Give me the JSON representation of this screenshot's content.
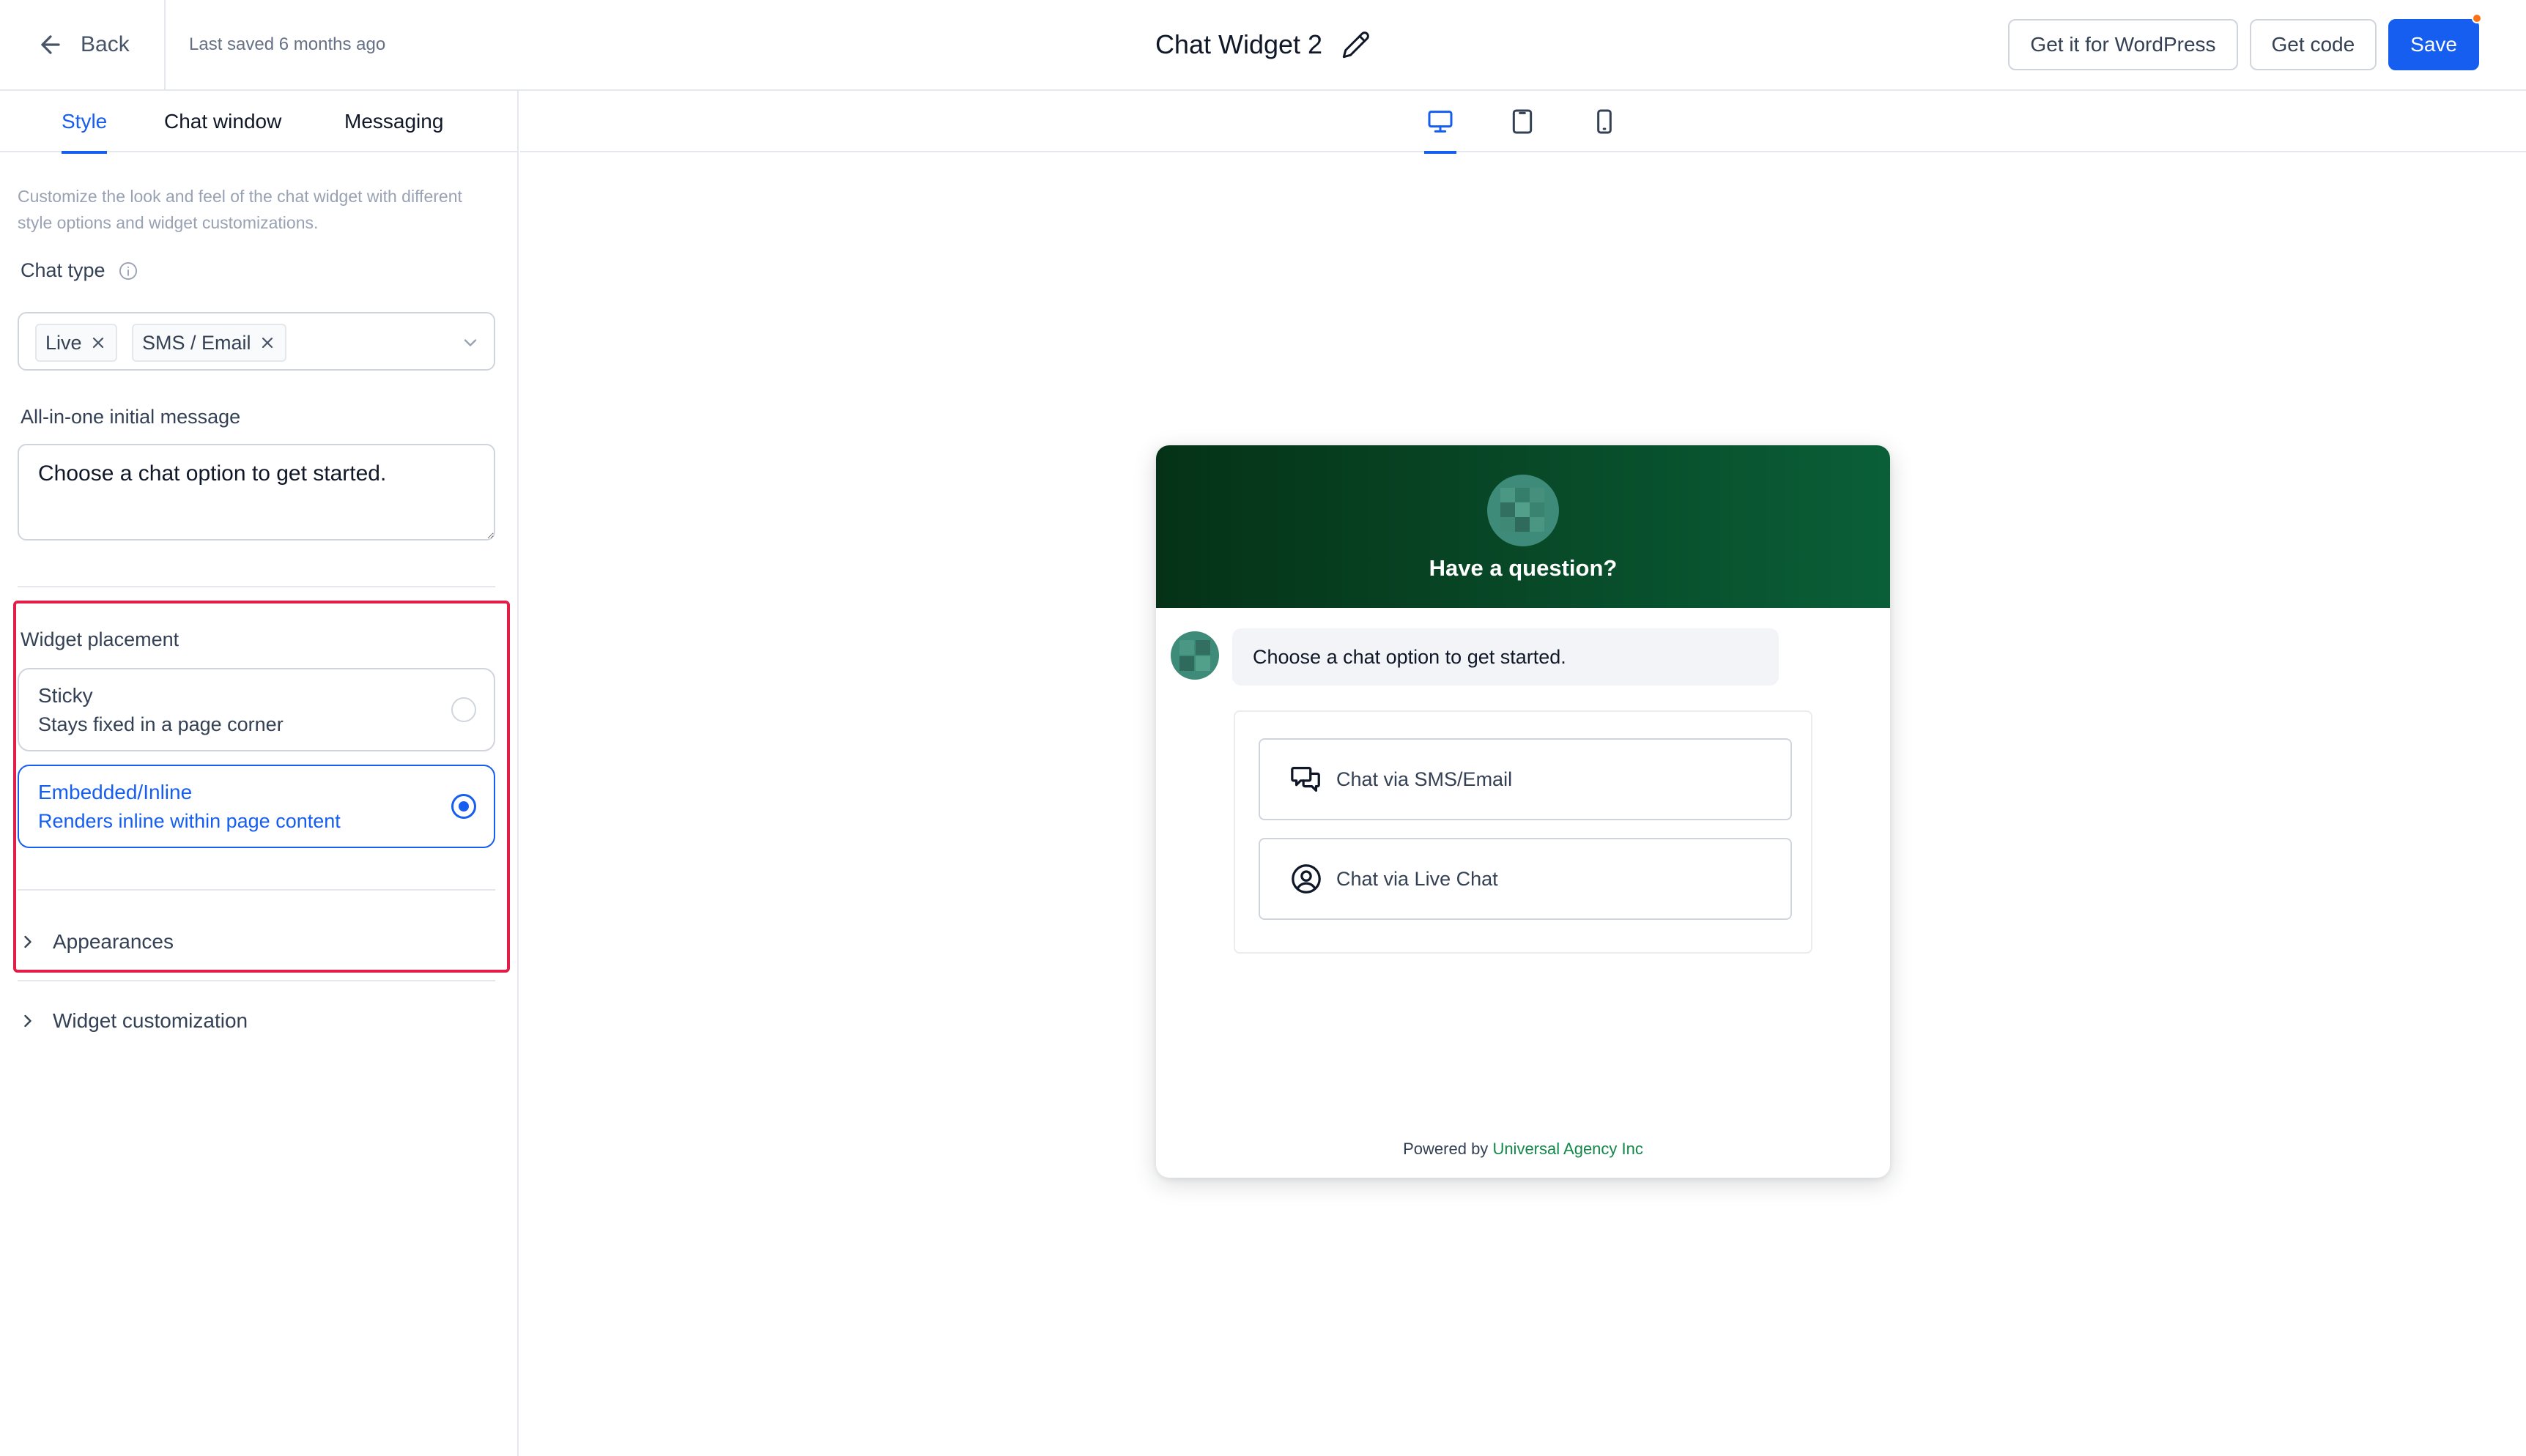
{
  "header": {
    "back_label": "Back",
    "last_saved": "Last saved 6 months ago",
    "title": "Chat Widget 2",
    "wordpress_label": "Get it for WordPress",
    "get_code_label": "Get code",
    "save_label": "Save"
  },
  "tabs": [
    {
      "label": "Style",
      "active": true
    },
    {
      "label": "Chat window",
      "active": false
    },
    {
      "label": "Messaging",
      "active": false
    }
  ],
  "style": {
    "description": "Customize the look and feel of the chat widget with different style options and widget customizations.",
    "chat_type_label": "Chat type",
    "chat_types": [
      "Live",
      "SMS / Email"
    ],
    "initial_message_label": "All-in-one initial message",
    "initial_message": "Choose a chat option to get started.",
    "placement_label": "Widget placement",
    "placements": [
      {
        "title": "Sticky",
        "subtitle": "Stays fixed in a page corner",
        "selected": false
      },
      {
        "title": "Embedded/Inline",
        "subtitle": "Renders inline within page content",
        "selected": true
      }
    ],
    "accordions": [
      "Appearances",
      "Widget customization"
    ]
  },
  "device_preview": {
    "options": [
      "desktop",
      "tablet",
      "mobile"
    ],
    "active": "desktop"
  },
  "widget": {
    "title": "Have a question?",
    "message": "Choose a chat option to get started.",
    "options": [
      {
        "label": "Chat via SMS/Email",
        "icon": "chat-bubbles-icon"
      },
      {
        "label": "Chat via Live Chat",
        "icon": "user-circle-icon"
      }
    ],
    "powered_by": "Powered by",
    "brand": "Universal Agency Inc"
  },
  "colors": {
    "accent": "#155eef",
    "highlight": "#e11d48",
    "widget_header_start": "#053217",
    "widget_header_end": "#0a5f38",
    "brand_link": "#12874a",
    "notification_dot": "#f97316"
  }
}
